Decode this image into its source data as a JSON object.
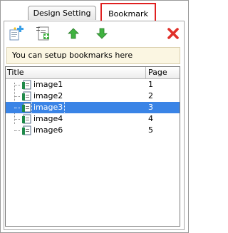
{
  "tabs": [
    {
      "label": "Design Setting"
    },
    {
      "label": "Bookmark"
    }
  ],
  "toolbar": {
    "add_icon": "add-bookmark-icon",
    "add_sub_icon": "add-sub-bookmark-icon",
    "up_icon": "arrow-up-icon",
    "down_icon": "arrow-down-icon",
    "delete_icon": "delete-icon"
  },
  "hint": "You can setup bookmarks here",
  "table": {
    "columns": [
      "Title",
      "Page"
    ],
    "rows": [
      {
        "title": "image1",
        "page": "1"
      },
      {
        "title": "image2",
        "page": "2"
      },
      {
        "title": "image3",
        "page": "3"
      },
      {
        "title": "image4",
        "page": "4"
      },
      {
        "title": "image6",
        "page": "5"
      }
    ],
    "selected_index": 2
  },
  "colors": {
    "selection": "#3a84e6",
    "highlight_border": "#e02020",
    "hint_bg": "#fbf6e2"
  }
}
